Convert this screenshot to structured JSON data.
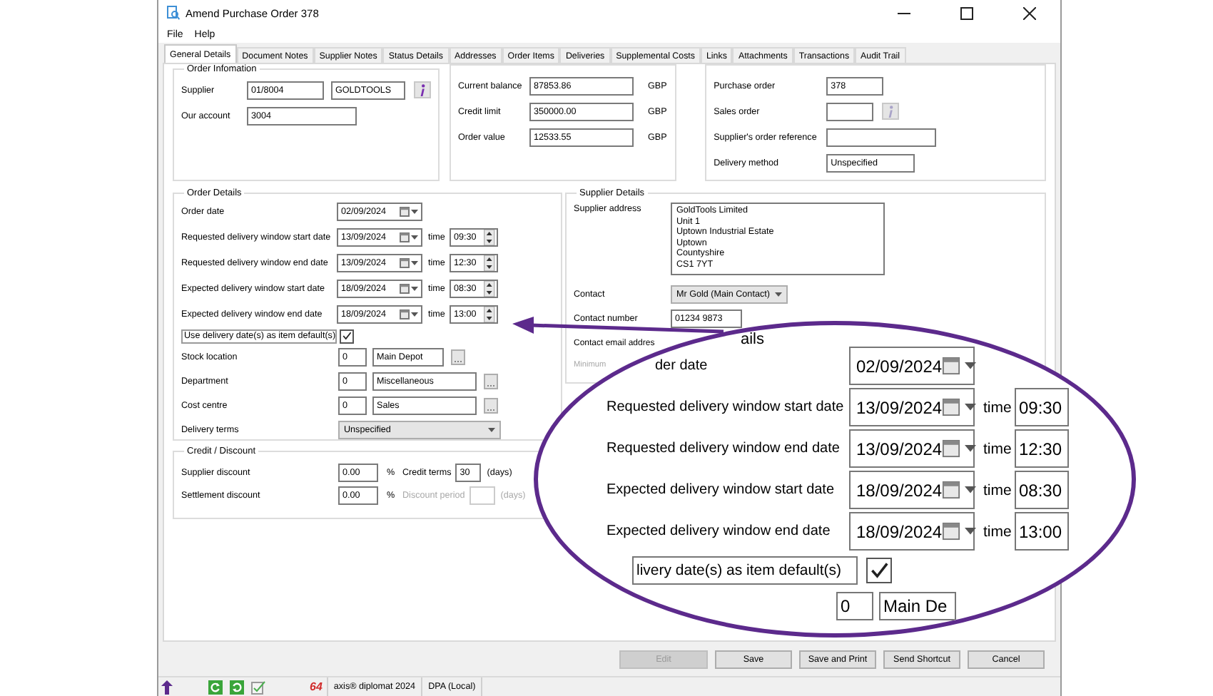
{
  "window": {
    "title": "Amend Purchase Order 378"
  },
  "menu": [
    "File",
    "Help"
  ],
  "tabs": [
    {
      "label": "General Details",
      "selected": true
    },
    {
      "label": "Document Notes",
      "selected": false
    },
    {
      "label": "Supplier Notes",
      "selected": false
    },
    {
      "label": "Status Details",
      "selected": false
    },
    {
      "label": "Addresses",
      "selected": false
    },
    {
      "label": "Order Items",
      "selected": false
    },
    {
      "label": "Deliveries",
      "selected": false
    },
    {
      "label": "Supplemental Costs",
      "selected": false
    },
    {
      "label": "Links",
      "selected": false
    },
    {
      "label": "Attachments",
      "selected": false
    },
    {
      "label": "Transactions",
      "selected": false
    },
    {
      "label": "Audit Trail",
      "selected": false
    }
  ],
  "order_information": {
    "title": "Order Infomation",
    "supplier_label": "Supplier",
    "supplier_code": "01/8004",
    "supplier_name": "GOLDTOOLS",
    "account_label": "Our account",
    "account": "3004"
  },
  "balances": [
    {
      "label": "Current balance",
      "value": "87853.86",
      "currency": "GBP"
    },
    {
      "label": "Credit limit",
      "value": "350000.00",
      "currency": "GBP"
    },
    {
      "label": "Order value",
      "value": "12533.55",
      "currency": "GBP"
    }
  ],
  "order_refs": [
    {
      "label": "Purchase order",
      "value": "378",
      "kind": "short"
    },
    {
      "label": "Sales order",
      "kind": "info"
    },
    {
      "label": "Supplier's order reference",
      "kind": "long"
    },
    {
      "label": "Delivery method",
      "value": "Unspecified",
      "kind": "medium"
    }
  ],
  "order_details": {
    "title": "Order Details",
    "dates": [
      {
        "label": "Order date",
        "date": "02/09/2024"
      },
      {
        "label": "Requested delivery window start date",
        "date": "13/09/2024",
        "time_label": "time",
        "time": "09:30"
      },
      {
        "label": "Requested delivery window end date",
        "date": "13/09/2024",
        "time_label": "time",
        "time": "12:30"
      },
      {
        "label": "Expected delivery window start date",
        "date": "18/09/2024",
        "time_label": "time",
        "time": "08:30"
      },
      {
        "label": "Expected delivery window end date",
        "date": "18/09/2024",
        "time_label": "time",
        "time": "13:00"
      }
    ],
    "use_default": {
      "label": "Use delivery date(s) as item default(s)",
      "checked": true
    },
    "lookups": [
      {
        "label": "Stock location",
        "code": "0",
        "value": "Main Depot",
        "kind": "short"
      },
      {
        "label": "Department",
        "code": "0",
        "value": "Miscellaneous",
        "kind": "long"
      },
      {
        "label": "Cost centre",
        "code": "0",
        "value": "Sales",
        "kind": "long"
      }
    ],
    "delivery_terms": {
      "label": "Delivery terms",
      "value": "Unspecified"
    }
  },
  "credit_discount": {
    "title": "Credit / Discount",
    "rows": [
      {
        "label": "Supplier discount",
        "value": "0.00",
        "unit": "%",
        "term_label": "Credit terms",
        "term_value": "30",
        "term_unit": "(days)",
        "disabled": false
      },
      {
        "label": "Settlement discount",
        "value": "0.00",
        "unit": "%",
        "term_label": "Discount period",
        "term_unit": "(days)",
        "disabled": true
      }
    ]
  },
  "supplier_details": {
    "title": "Supplier Details",
    "address_label": "Supplier address",
    "address_lines": [
      "GoldTools Limited",
      "Unit 1",
      "Uptown Industrial Estate",
      "Uptown",
      "Countyshire",
      "CS1 7YT"
    ],
    "contact_label": "Contact",
    "contact": "Mr Gold (Main Contact)",
    "number_label": "Contact number",
    "number": "01234 9873",
    "email_label": "Contact email addres",
    "minimum_label": "Minimum"
  },
  "buttons": [
    {
      "label": "Edit",
      "disabled": true
    },
    {
      "label": "Save",
      "disabled": false
    },
    {
      "label": "Save and Print",
      "disabled": false
    },
    {
      "label": "Send Shortcut",
      "disabled": false
    },
    {
      "label": "Cancel",
      "disabled": false
    }
  ],
  "status_bar": {
    "logo": "64",
    "product": "axis® diplomat 2024",
    "connection": "DPA (Local)"
  },
  "magnifier": {
    "heading": "ails",
    "first_row": {
      "label": "der date",
      "date": "02/09/2024"
    },
    "rows": [
      {
        "label": "Requested delivery window start date",
        "date": "13/09/2024",
        "time_label": "time",
        "time": "09:30"
      },
      {
        "label": "Requested delivery window end date",
        "date": "13/09/2024",
        "time_label": "time",
        "time": "12:30"
      },
      {
        "label": "Expected delivery window start date",
        "date": "18/09/2024",
        "time_label": "time",
        "time": "08:30"
      },
      {
        "label": "Expected delivery window end date",
        "date": "18/09/2024",
        "time_label": "time",
        "time": "13:00"
      }
    ],
    "default_checkbox": {
      "label": "livery date(s) as item default(s)",
      "checked": true
    },
    "lookup": {
      "code": "0",
      "value": "Main De"
    }
  }
}
